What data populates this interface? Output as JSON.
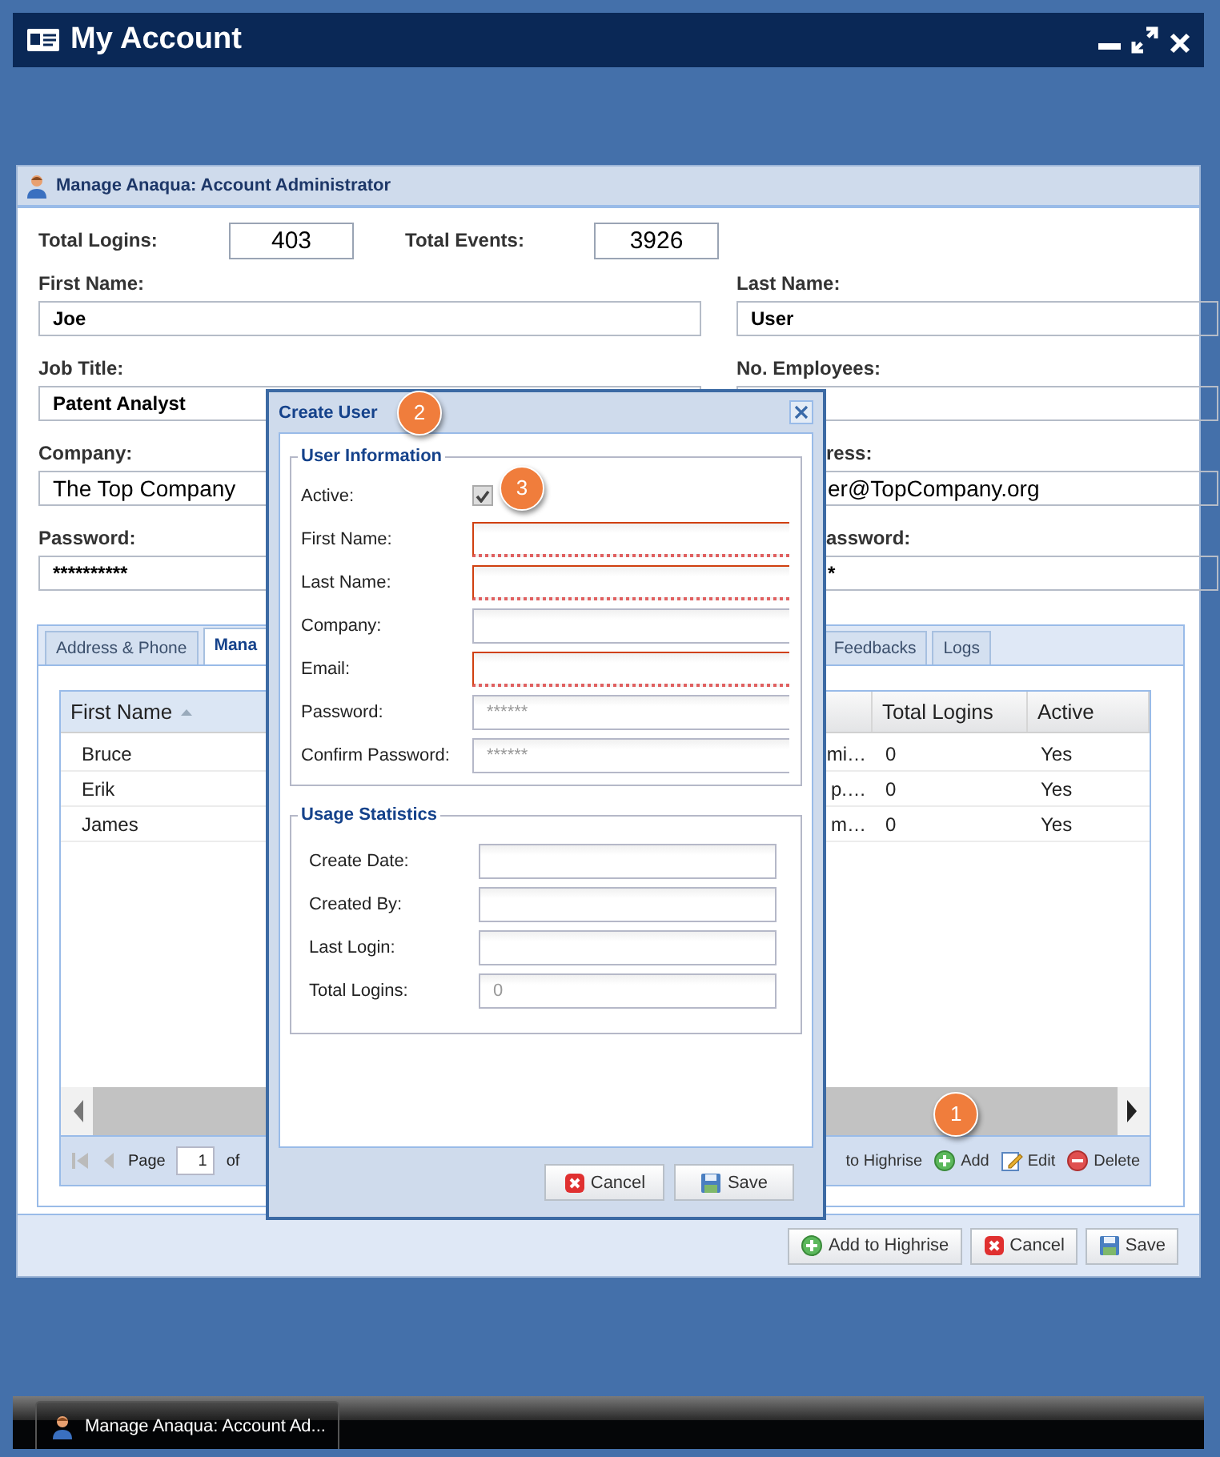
{
  "window": {
    "title": "My Account"
  },
  "panel": {
    "title": "Manage Anaqua: Account Administrator"
  },
  "stats": [
    {
      "label": "Total Logins:",
      "value": "403"
    },
    {
      "label": "Total Events:",
      "value": "3926"
    }
  ],
  "fields_left": [
    {
      "label": "First Name:",
      "value": "Joe",
      "kind": "bold"
    },
    {
      "label": "Job Title:",
      "value": "Patent Analyst",
      "kind": "bold"
    },
    {
      "label": "Company:",
      "value": "The Top Company",
      "kind": "large"
    },
    {
      "label": "Password:",
      "value": "**********",
      "kind": "bold"
    }
  ],
  "fields_right": [
    {
      "label": "Last Name:",
      "value": "User",
      "kind": "bold"
    },
    {
      "label": "No. Employees:"
    },
    {
      "label": "ress:",
      "value": "er@TopCompany.org",
      "kind": "large",
      "covered": true
    },
    {
      "label": "assword:",
      "value": "*",
      "kind": "bold",
      "covered": true
    }
  ],
  "tabs": [
    {
      "label": "Address & Phone",
      "selected": false,
      "covered": false
    },
    {
      "label": "Mana",
      "selected": true,
      "covered": false
    },
    {
      "label": "Feedbacks",
      "selected": false,
      "covered": true
    },
    {
      "label": "Logs",
      "selected": false,
      "covered": false
    }
  ],
  "grid": {
    "columns": [
      {
        "label": "First Name",
        "sorted": true
      },
      {
        "label": "Total Logins",
        "sorted": false
      },
      {
        "label": "Active",
        "sorted": false
      }
    ],
    "rows": [
      {
        "first_name": "Bruce",
        "column_2": "mi…",
        "total_logins": "0",
        "active": "Yes"
      },
      {
        "first_name": "Erik",
        "column_2": "p.…",
        "total_logins": "0",
        "active": "Yes"
      },
      {
        "first_name": "James",
        "column_2": "m…",
        "total_logins": "0",
        "active": "Yes"
      }
    ]
  },
  "paging": {
    "label": "Page",
    "page": "1",
    "of": "of"
  },
  "grid_toolbar": [
    {
      "kind": "text",
      "label": "to Highrise"
    },
    {
      "kind": "add",
      "label": "Add",
      "badge": "1"
    },
    {
      "kind": "edit",
      "label": "Edit"
    },
    {
      "kind": "delete",
      "label": "Delete"
    }
  ],
  "buttons": [
    {
      "kind": "add",
      "label": "Add to Highrise"
    },
    {
      "kind": "cancel",
      "label": "Cancel"
    },
    {
      "kind": "save",
      "label": "Save"
    }
  ],
  "dialog": {
    "title": "Create User",
    "badge": "2",
    "sections": [
      {
        "title": "User Information",
        "kind": "wide",
        "fields": [
          {
            "label": "Active:",
            "kind": "checkbox",
            "checked": true,
            "badge": "3"
          },
          {
            "label": "First Name:",
            "kind": "text",
            "invalid": true
          },
          {
            "label": "Last Name:",
            "kind": "text",
            "invalid": true
          },
          {
            "label": "Company:",
            "kind": "text",
            "invalid": false
          },
          {
            "label": "Email:",
            "kind": "text",
            "invalid": true
          },
          {
            "label": "Password:",
            "kind": "text",
            "invalid": false,
            "placeholder": "******"
          },
          {
            "label": "Confirm Password:",
            "kind": "text",
            "invalid": false,
            "placeholder": "******"
          }
        ]
      },
      {
        "title": "Usage Statistics",
        "kind": "narrow",
        "fields": [
          {
            "label": "Create Date:",
            "kind": "text",
            "invalid": false
          },
          {
            "label": "Created By:",
            "kind": "text",
            "invalid": false
          },
          {
            "label": "Last Login:",
            "kind": "text",
            "invalid": false
          },
          {
            "label": "Total Logins:",
            "kind": "text",
            "invalid": false,
            "placeholder": "0"
          }
        ]
      }
    ],
    "buttons": [
      {
        "kind": "cancel",
        "label": "Cancel"
      },
      {
        "kind": "save",
        "label": "Save"
      }
    ]
  },
  "taskbar": [
    {
      "label": "Manage Anaqua: Account Ad..."
    }
  ]
}
